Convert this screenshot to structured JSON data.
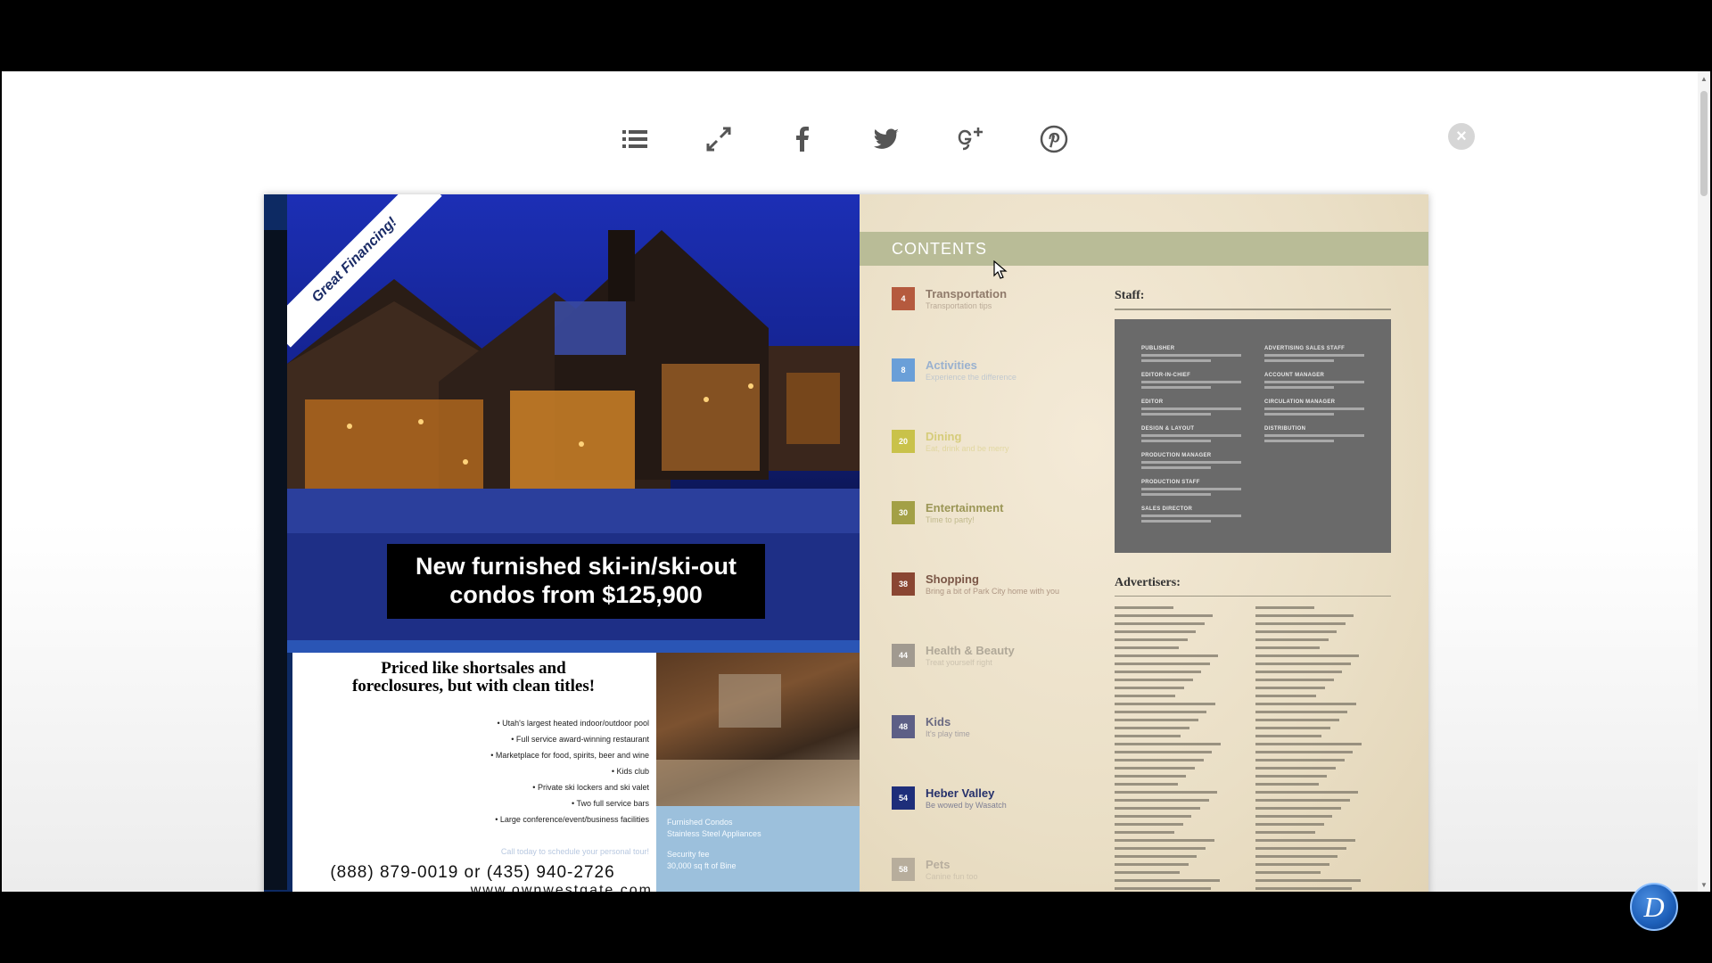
{
  "toolbar": {
    "icons": [
      "table-of-contents-icon",
      "fullscreen-icon",
      "facebook-icon",
      "twitter-icon",
      "google-plus-icon",
      "pinterest-icon"
    ]
  },
  "ad": {
    "ribbon": "Great Financing!",
    "headline_line1": "New furnished ski-in/ski-out",
    "headline_line2": "condos from $125,900",
    "tagline_line1": "Priced like shortsales and",
    "tagline_line2": "foreclosures, but with clean titles!",
    "bullets": [
      "• Utah's largest heated indoor/outdoor pool",
      "• Full service award-winning restaurant",
      "• Marketplace for food, spirits, beer and wine",
      "• Kids club",
      "• Private ski lockers and ski valet",
      "• Two full service bars",
      "• Large conference/event/business facilities"
    ],
    "cta": "Call today to schedule your personal tour!",
    "phone": "(888) 879-0019 or (435) 940-2726",
    "website": "www.ownwestgate.com",
    "info_line1": "Furnished Condos",
    "info_line2": "Stainless Steel Appliances",
    "info_line3": "Security fee",
    "info_line4": "30,000 sq ft of Bine"
  },
  "contents": {
    "title": "CONTENTS",
    "items": [
      {
        "num": "4",
        "title": "Transportation",
        "sub": "Transportation tips",
        "color": "#b55a3e",
        "title_color": "#8f7a6a"
      },
      {
        "num": "8",
        "title": "Activities",
        "sub": "Experience the difference",
        "color": "#6a9fd8",
        "title_color": "#9ab1cf"
      },
      {
        "num": "20",
        "title": "Dining",
        "sub": "Eat, drink and be merry",
        "color": "#c9c24a",
        "title_color": "#d6cc7a"
      },
      {
        "num": "30",
        "title": "Entertainment",
        "sub": "Time to party!",
        "color": "#a3a046",
        "title_color": "#9b9656"
      },
      {
        "num": "38",
        "title": "Shopping",
        "sub": "Bring a bit of Park City home with you",
        "color": "#8a4632",
        "title_color": "#7a5646"
      },
      {
        "num": "44",
        "title": "Health & Beauty",
        "sub": "Treat yourself right",
        "color": "#a19a90",
        "title_color": "#b0a898"
      },
      {
        "num": "48",
        "title": "Kids",
        "sub": "It's play time",
        "color": "#5d5f86",
        "title_color": "#6b6a82"
      },
      {
        "num": "54",
        "title": "Heber Valley",
        "sub": "Be wowed by Wasatch",
        "color": "#1e2e7a",
        "title_color": "#25306b"
      },
      {
        "num": "58",
        "title": "Pets",
        "sub": "Canine fun too",
        "color": "#b7ad9c",
        "title_color": "#b8ae9e"
      }
    ],
    "staff_heading": "Staff:",
    "staff_left": [
      "PUBLISHER",
      "EDITOR-IN-CHIEF",
      "EDITOR",
      "DESIGN & LAYOUT",
      "PRODUCTION MANAGER",
      "PRODUCTION STAFF",
      "SALES DIRECTOR"
    ],
    "staff_right": [
      "ADVERTISING SALES STAFF",
      "ACCOUNT MANAGER",
      "CIRCULATION MANAGER",
      "DISTRIBUTION"
    ],
    "advertisers_heading": "Advertisers:"
  },
  "logo": {
    "letter": "D"
  }
}
